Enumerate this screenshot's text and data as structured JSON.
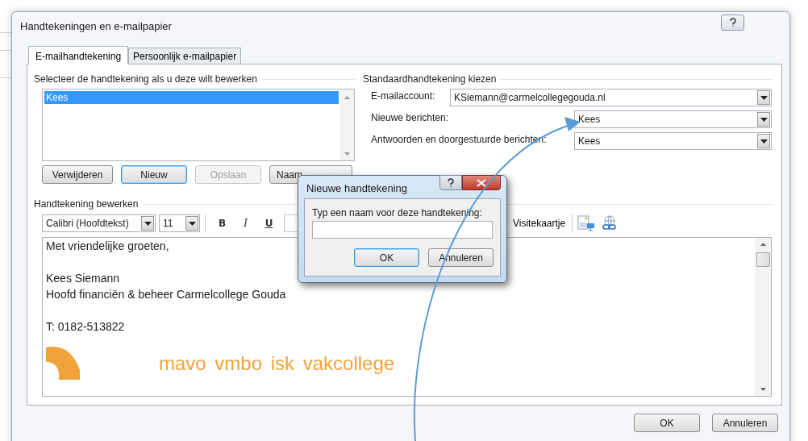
{
  "window": {
    "title": "Handtekeningen en e-mailpapier"
  },
  "tabs": [
    {
      "label": "E-mailhandtekening",
      "selected": true
    },
    {
      "label": "Persoonlijk e-mailpapier",
      "selected": false
    }
  ],
  "signature_list": {
    "heading": "Selecteer de handtekening als u deze wilt bewerken",
    "items": [
      {
        "label": "Kees",
        "selected": true
      }
    ],
    "buttons": [
      {
        "label": "Verwijderen",
        "default": false,
        "disabled": false
      },
      {
        "label": "Nieuw",
        "default": true,
        "disabled": false
      },
      {
        "label": "Opslaan",
        "default": false,
        "disabled": true
      },
      {
        "label": "Naam",
        "default": false,
        "disabled": false
      }
    ]
  },
  "defaults": {
    "heading": "Standaardhandtekening kiezen",
    "fields": [
      {
        "label": "E-mailaccount:",
        "value": "KSiemann@carmelcollegegouda.nl",
        "kind": "wide"
      },
      {
        "label": "Nieuwe berichten:",
        "value": "Kees",
        "kind": "narrow"
      },
      {
        "label": "Antwoorden en doorgestuurde berichten:",
        "value": "Kees",
        "kind": "narrow"
      }
    ]
  },
  "editor": {
    "heading": "Handtekening bewerken",
    "font": "Calibri (Hoofdtekst)",
    "size": "11",
    "format_buttons": [
      {
        "label": "B",
        "kind": "bold"
      },
      {
        "label": "I",
        "kind": "italic"
      },
      {
        "label": "U",
        "kind": "underline"
      }
    ],
    "business_card": "Visitekaartje",
    "paragraphs": [
      [
        "Met vriendelijke groeten,"
      ],
      [
        "Kees Siemann",
        "Hoofd financiën & beheer Carmelcollege Gouda"
      ],
      [
        "T: 0182-513822"
      ]
    ],
    "logo_text": "mavo vmbo isk vakcollege"
  },
  "footer_buttons": [
    {
      "label": "OK",
      "default": false
    },
    {
      "label": "Annuleren",
      "default": false
    }
  ],
  "new_signature_dialog": {
    "title": "Nieuwe handtekening",
    "prompt": "Typ een naam voor deze handtekening:",
    "buttons": [
      {
        "label": "OK",
        "default": true
      },
      {
        "label": "Annuleren",
        "default": false
      }
    ]
  }
}
